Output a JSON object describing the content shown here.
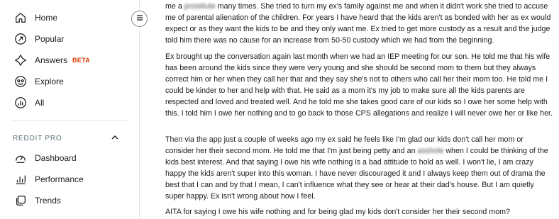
{
  "sidebar": {
    "items": [
      {
        "label": "Home",
        "icon": "home-icon"
      },
      {
        "label": "Popular",
        "icon": "popular-arrow-icon"
      },
      {
        "label": "Answers",
        "icon": "answers-icon",
        "badge": "BETA"
      },
      {
        "label": "Explore",
        "icon": "explore-icon"
      },
      {
        "label": "All",
        "icon": "all-icon"
      }
    ],
    "pro_section": {
      "title": "REDDIT PRO",
      "items": [
        {
          "label": "Dashboard",
          "icon": "dashboard-icon"
        },
        {
          "label": "Performance",
          "icon": "performance-chart-icon"
        },
        {
          "label": "Trends",
          "icon": "trends-icon"
        }
      ]
    }
  },
  "post": {
    "p1": {
      "before": "me a ",
      "blurred": "prostitute",
      "after": " many times. She tried to turn my ex's family against me and when it didn't work she tried to accuse me of parental alienation of the children. For years I have heard that the kids aren't as bonded with her as ex would expect or as they want the kids to be and they only want me. Ex tried to get more custody as a result and the judge told him there was no cause for an increase from 50-50 custody which we had from the beginning."
    },
    "p2": "Ex brought up the conversation again last month when we had an IEP meeting for our son. He told me that his wife has been around the kids since they were very young and she should be second mom to them but they always correct him or her when they call her that and they say she's not to others who call her their mom too. He told me I could be kinder to her and help with that. He said as a mom it's my job to make sure all the kids parents are respected and loved and treated well. And he told me she takes good care of our kids so I owe her some help with this. I told him I owe her nothing and to go back to those CPS allegations and realize I will never owe her or like her.",
    "p3": {
      "before": "Then via the app just a couple of weeks ago my ex said he feels like I'm glad our kids don't call her mom or consider her their second mom. He told me that I'm just being petty and an ",
      "blurred": "asshole",
      "after": " when I could be thinking of the kids best interest. And that saying I owe his wife nothing is a bad attitude to hold as well. I won't lie, I am crazy happy the kids aren't super into this woman. I have never discouraged it and I always keep them out of drama the best that I can and by that I mean, I can't influence what they see or hear at their dad's house. But I am quietly super happy. Ex isn't wrong about how I feel."
    },
    "p4": "AITA for saying I owe his wife nothing and for being glad my kids don't consider her their second mom?"
  },
  "colors": {
    "beta": "#d93a00",
    "section_heading": "#576f76",
    "divider": "#e5e5e5"
  }
}
